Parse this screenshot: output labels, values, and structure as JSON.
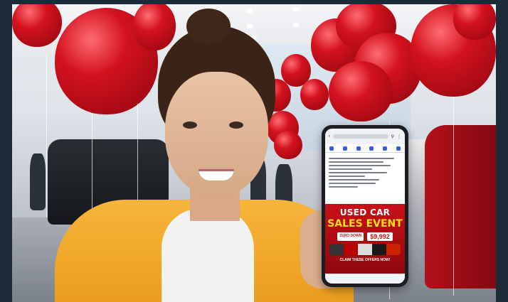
{
  "scene": {
    "description_subject": "woman-holding-phone-in-car-showroom",
    "balloon_color": "#d3121e",
    "shirt_color": "#f2a62b"
  },
  "phone_ad": {
    "headline_line1": "USED CAR",
    "headline_line2": "SALES EVENT",
    "offer_left": "ZERO DOWN",
    "price": "$9,992",
    "cta": "CLAIM THESE OFFERS NOW!",
    "accent_color": "#c91018",
    "headline_color": "#ffe11a"
  }
}
